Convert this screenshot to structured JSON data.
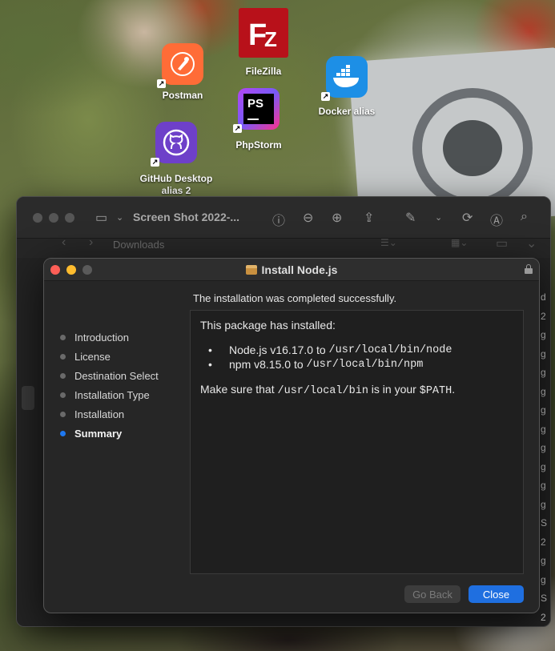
{
  "desktop": {
    "icons": [
      {
        "label": "FileZilla",
        "icon": "filezilla-icon",
        "color": "#b8111a"
      },
      {
        "label": "Postman",
        "icon": "postman-icon",
        "color": "#ff6c37"
      },
      {
        "label": "Docker alias",
        "icon": "docker-icon",
        "color": "#1d8fe6"
      },
      {
        "label": "PhpStorm",
        "icon": "phpstorm-icon",
        "color": "#9b3cd8"
      },
      {
        "label": "GitHub Desktop alias 2",
        "icon": "github-desktop-icon",
        "color": "#6e40c9"
      }
    ]
  },
  "preview": {
    "title": "Screen Shot 2022-...",
    "breadcrumb": "Downloads",
    "right_column": [
      "d",
      "2",
      "g",
      "g",
      "g",
      "g",
      "g",
      "g",
      "g",
      "g",
      "g",
      "g",
      "S",
      "2",
      "g",
      "g",
      "S",
      "2"
    ]
  },
  "installer": {
    "title": "Install Node.js",
    "status": "The installation was completed successfully.",
    "steps": [
      {
        "label": "Introduction",
        "active": false
      },
      {
        "label": "License",
        "active": false
      },
      {
        "label": "Destination Select",
        "active": false
      },
      {
        "label": "Installation Type",
        "active": false
      },
      {
        "label": "Installation",
        "active": false
      },
      {
        "label": "Summary",
        "active": true
      }
    ],
    "content": {
      "heading": "This package has installed:",
      "items": [
        {
          "bullet": "•",
          "text": "Node.js v16.17.0 to ",
          "path": "/usr/local/bin/node"
        },
        {
          "bullet": "•",
          "text": "npm v8.15.0 to ",
          "path": "/usr/local/bin/npm"
        }
      ],
      "note_prefix": "Make sure that ",
      "note_path": "/usr/local/bin",
      "note_middle": " is in your ",
      "note_var": "$PATH",
      "note_suffix": "."
    },
    "buttons": {
      "back": "Go Back",
      "close": "Close"
    },
    "colors": {
      "accent": "#1f6fe0",
      "close_red": "#ff5f57",
      "minimize_yellow": "#febc2e"
    }
  }
}
